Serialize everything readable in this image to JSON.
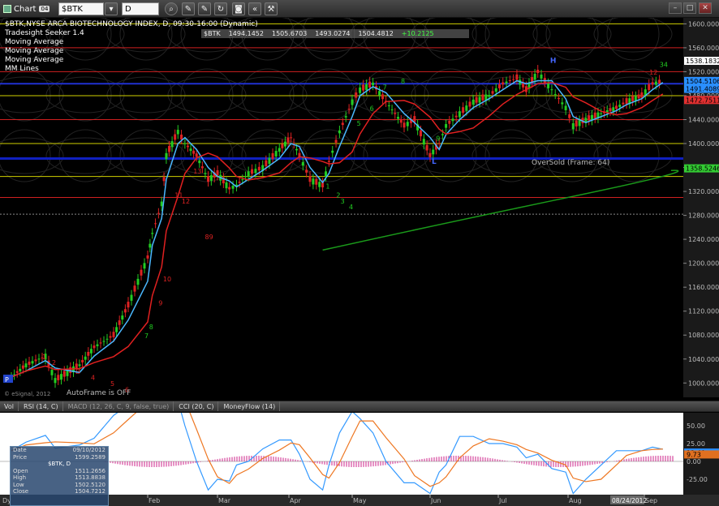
{
  "toolbar": {
    "app_label": "Chart",
    "link_badge": "04",
    "symbol": "$BTK",
    "interval": "D",
    "icons": [
      "magnifier-icon",
      "pencil-icon",
      "pencil-icon",
      "refresh-icon",
      "camera-icon",
      "rewind-icon",
      "wrench-icon"
    ]
  },
  "window_controls": [
    "minimize",
    "maximize",
    "close"
  ],
  "legend": {
    "title": "$BTK,NYSE ARCA BIOTECHNOLOGY INDEX, D, 09:30-16:00 (Dynamic)",
    "studies": [
      "Tradesight Seeker 1.4",
      "Moving Average",
      "Moving Average",
      "Moving Average",
      "MM Lines"
    ],
    "quote_symbol": "$BTK",
    "quote_values": [
      "1494.1452",
      "1505.6703",
      "1493.0274",
      "1504.4812",
      "+10.2125"
    ]
  },
  "price_axis": {
    "ticks": [
      "1600.0000",
      "1560.0000",
      "1520.0000",
      "1480.0000",
      "1440.0000",
      "1400.0000",
      "1360.0000",
      "1320.0000",
      "1280.0000",
      "1240.0000",
      "1200.0000",
      "1160.0000",
      "1120.0000",
      "1080.0000",
      "1040.0000",
      "1000.0000"
    ],
    "badges": [
      {
        "label": "1538.1832",
        "color": "#ffffff"
      },
      {
        "label": "1504.5106",
        "color": "#2a8fff"
      },
      {
        "label": "1491.4089",
        "color": "#2a8fff"
      },
      {
        "label": "1472.7511",
        "color": "#e03030"
      },
      {
        "label": "1358.5246",
        "color": "#33cc33"
      }
    ]
  },
  "annotations": {
    "oversold": "OverSold (Frame: 64)",
    "autoframe": "AutoFrame is OFF",
    "copyright": "© eSignal, 2012",
    "marker_H": "H",
    "marker_L": "L",
    "marker_P": "P"
  },
  "seeker_counts": [
    "1",
    "2",
    "3",
    "4",
    "5",
    "6",
    "7",
    "8",
    "9",
    "10",
    "11",
    "12",
    "13",
    "89",
    "1",
    "2",
    "3",
    "4",
    "5",
    "6",
    "7",
    "8",
    "9",
    "12",
    "34"
  ],
  "study_tabs": [
    "Vol",
    "RSI (14, C)",
    "MACD (12, 26, C, 9, false, true)",
    "CCI (20, C)",
    "MoneyFlow (14)"
  ],
  "macd": {
    "label": "MACD",
    "ticks": [
      "75.00",
      "50.00",
      "25.00",
      "0.00",
      "-25.00"
    ],
    "badges": [
      "12.40",
      "9.73"
    ]
  },
  "date_axis": {
    "months": [
      "Feb",
      "Mar",
      "Apr",
      "May",
      "Jun",
      "Jul",
      "Aug",
      "Sep"
    ],
    "highlighted_date": "08/24/2012",
    "corner": "Dy"
  },
  "data_window": {
    "date_label": "Date",
    "date_value": "09/10/2012",
    "price_label": "Price",
    "price_value": "1599.2589",
    "symbol": "$BTK, D",
    "open_label": "Open",
    "open_value": "1511.2656",
    "high_label": "High",
    "high_value": "1513.8838",
    "low_label": "Low",
    "low_value": "1502.5120",
    "close_label": "Close",
    "close_value": "1504.7212"
  },
  "chart_data": {
    "type": "line",
    "x_range": [
      "2012-01-03",
      "2012-09-14"
    ],
    "ylim": [
      976,
      1610
    ],
    "close_series": [
      [
        "Jan-03",
        1010
      ],
      [
        "Jan-06",
        1030
      ],
      [
        "Jan-10",
        1045
      ],
      [
        "Jan-12",
        1005
      ],
      [
        "Jan-17",
        1030
      ],
      [
        "Jan-20",
        1060
      ],
      [
        "Jan-24",
        1080
      ],
      [
        "Jan-27",
        1130
      ],
      [
        "Feb-01",
        1210
      ],
      [
        "Feb-03",
        1250
      ],
      [
        "Feb-07",
        1300
      ],
      [
        "Feb-09",
        1380
      ],
      [
        "Feb-14",
        1420
      ],
      [
        "Feb-17",
        1400
      ],
      [
        "Feb-22",
        1380
      ],
      [
        "Feb-27",
        1340
      ],
      [
        "Mar-01",
        1350
      ],
      [
        "Mar-06",
        1325
      ],
      [
        "Mar-09",
        1330
      ],
      [
        "Mar-14",
        1350
      ],
      [
        "Mar-20",
        1360
      ],
      [
        "Mar-27",
        1390
      ],
      [
        "Apr-02",
        1410
      ],
      [
        "Apr-06",
        1380
      ],
      [
        "Apr-11",
        1340
      ],
      [
        "Apr-17",
        1330
      ],
      [
        "Apr-20",
        1370
      ],
      [
        "Apr-25",
        1420
      ],
      [
        "May-01",
        1470
      ],
      [
        "May-04",
        1490
      ],
      [
        "May-09",
        1500
      ],
      [
        "May-14",
        1470
      ],
      [
        "May-21",
        1430
      ],
      [
        "May-25",
        1440
      ],
      [
        "Jun-01",
        1380
      ],
      [
        "Jun-05",
        1400
      ],
      [
        "Jun-08",
        1430
      ],
      [
        "Jun-14",
        1450
      ],
      [
        "Jun-20",
        1470
      ],
      [
        "Jun-27",
        1480
      ],
      [
        "Jul-03",
        1500
      ],
      [
        "Jul-09",
        1510
      ],
      [
        "Jul-13",
        1490
      ],
      [
        "Jul-18",
        1520
      ],
      [
        "Jul-24",
        1490
      ],
      [
        "Jul-30",
        1460
      ],
      [
        "Aug-03",
        1430
      ],
      [
        "Aug-08",
        1440
      ],
      [
        "Aug-14",
        1450
      ],
      [
        "Aug-20",
        1460
      ],
      [
        "Aug-24",
        1470
      ],
      [
        "Aug-30",
        1480
      ],
      [
        "Sep-05",
        1500
      ],
      [
        "Sep-10",
        1504
      ]
    ],
    "series": [
      {
        "name": "Moving Average",
        "color": "#4ab8ff"
      },
      {
        "name": "Moving Average",
        "color": "#e02020"
      },
      {
        "name": "Moving Average",
        "color": "#1a9a1a"
      }
    ]
  }
}
